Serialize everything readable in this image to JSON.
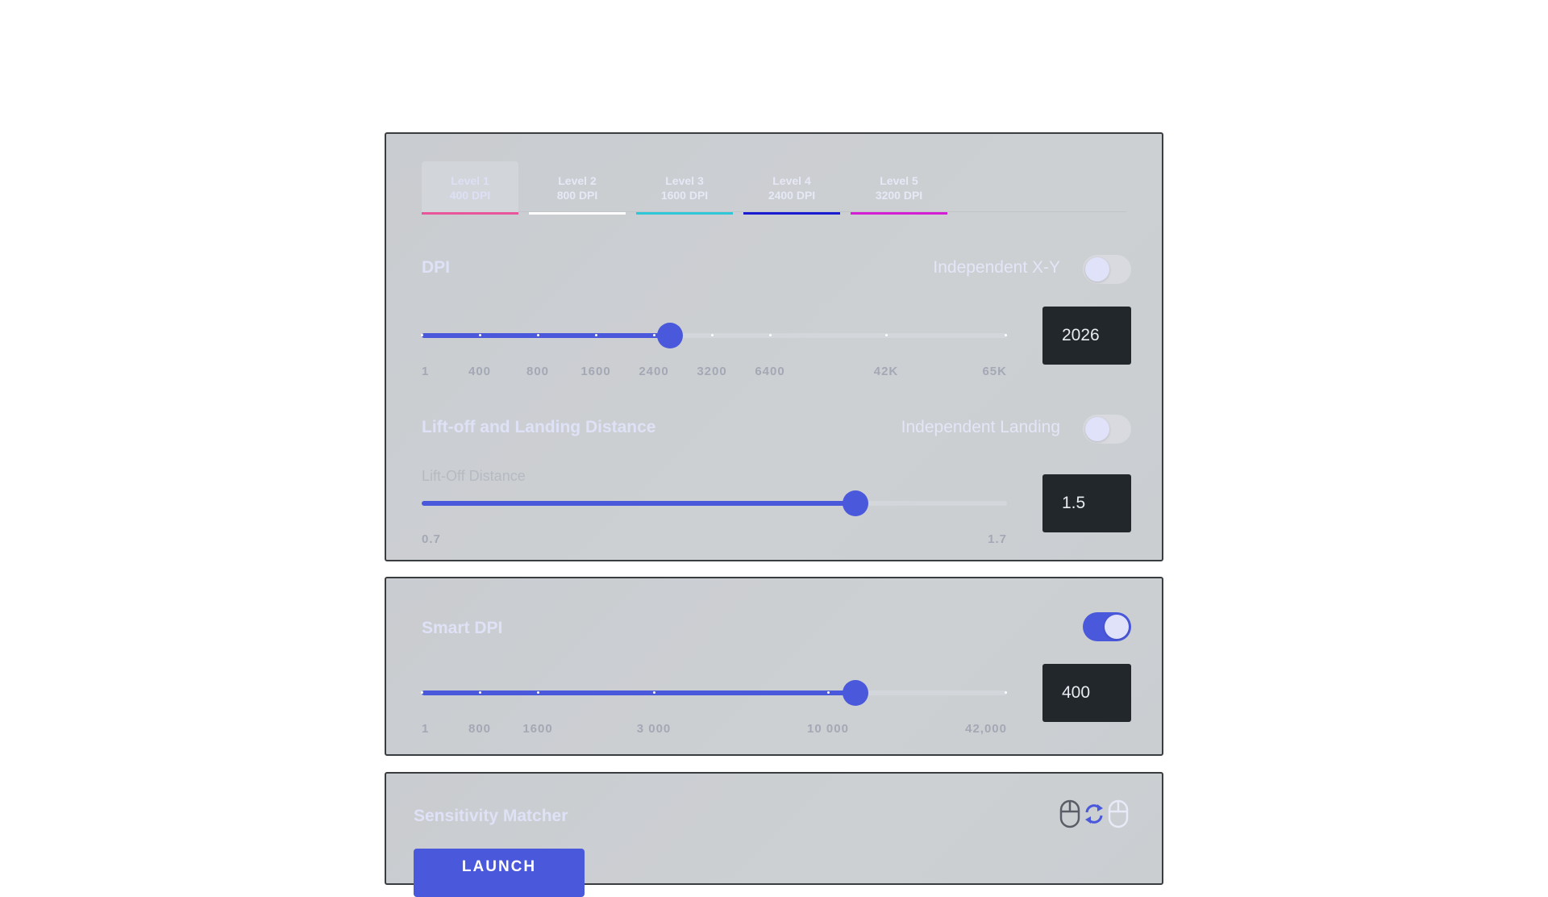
{
  "tabs": [
    {
      "line1": "Level 1",
      "line2": "400 DPI",
      "color": "#e8559a",
      "active": true
    },
    {
      "line1": "Level 2",
      "line2": "800 DPI",
      "color": "#ffffff"
    },
    {
      "line1": "Level 3",
      "line2": "1600 DPI",
      "color": "#2fc6d8"
    },
    {
      "line1": "Level 4",
      "line2": "2400 DPI",
      "color": "#1a1ad0"
    },
    {
      "line1": "Level 5",
      "line2": "3200 DPI",
      "color": "#d41ed4"
    }
  ],
  "dpi": {
    "title": "DPI",
    "toggle_label": "Independent X-Y",
    "toggle_on": false,
    "value": "2026",
    "ticks": [
      "1",
      "400",
      "800",
      "1600",
      "2400",
      "3200",
      "6400",
      "42K",
      "65K"
    ]
  },
  "liftoff": {
    "title": "Lift-off and Landing Distance",
    "toggle_label": "Independent Landing",
    "toggle_on": false,
    "sublabel": "Lift-Off Distance",
    "value": "1.5",
    "min": "0.7",
    "max": "1.7",
    "fraction": 0.74
  },
  "smart_dpi": {
    "title": "Smart DPI",
    "toggle_on": true,
    "value": "400",
    "ticks": [
      "1",
      "800",
      "1600",
      "3 000",
      "10 000",
      "42,000"
    ]
  },
  "sensitivity": {
    "title": "Sensitivity Matcher",
    "launch_label": "LAUNCH"
  },
  "colors": {
    "accent": "#4a58dc",
    "card_bg": "#cbced2",
    "value_box": "#22272c"
  },
  "icons": [
    "mouse-icon",
    "sync-icon",
    "mouse-icon"
  ]
}
